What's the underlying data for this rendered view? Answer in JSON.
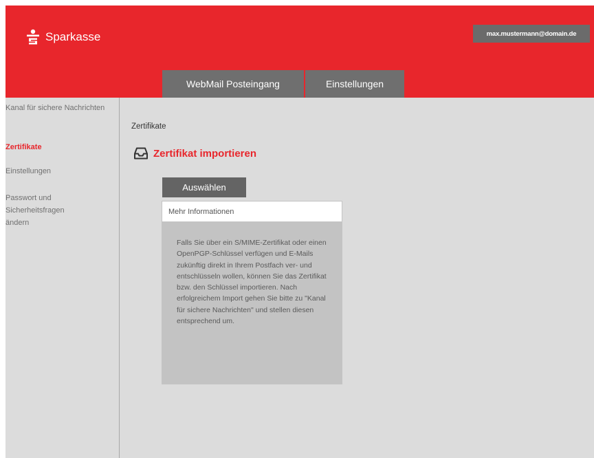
{
  "header": {
    "brand": "Sparkasse",
    "user_email": "max.mustermann@domain.de",
    "tabs": [
      {
        "label": "WebMail Posteingang"
      },
      {
        "label": "Einstellungen"
      }
    ]
  },
  "sidebar": {
    "items": [
      {
        "label": "Kanal für sichere Nachrichten",
        "active": false
      },
      {
        "label": "Zertifikate",
        "active": true
      },
      {
        "label": "Einstellungen",
        "active": false
      },
      {
        "label": "Passwort und Sicherheitsfragen ändern",
        "active": false
      }
    ]
  },
  "main": {
    "section_title": "Zertifikate",
    "import_heading": "Zertifikat importieren",
    "select_button": "Auswählen",
    "info_header": "Mehr Informationen",
    "info_text": "Falls Sie über ein S/MIME-Zertifikat oder einen OpenPGP-Schlüssel verfügen und E-Mails zukünftig direkt in Ihrem Postfach ver- und entschlüsseln wollen, können Sie das Zertifikat bzw. den Schlüssel importieren. Nach erfolgreichem Import gehen Sie bitte zu \"Kanal für sichere Nachrichten\" und stellen diesen entsprechend um."
  },
  "colors": {
    "brand_red": "#e8262c",
    "tab_gray": "#6f6f6f",
    "background_gray": "#dcdcdc"
  },
  "icons": [
    "sparkasse-logo-icon",
    "inbox-tray-icon"
  ]
}
